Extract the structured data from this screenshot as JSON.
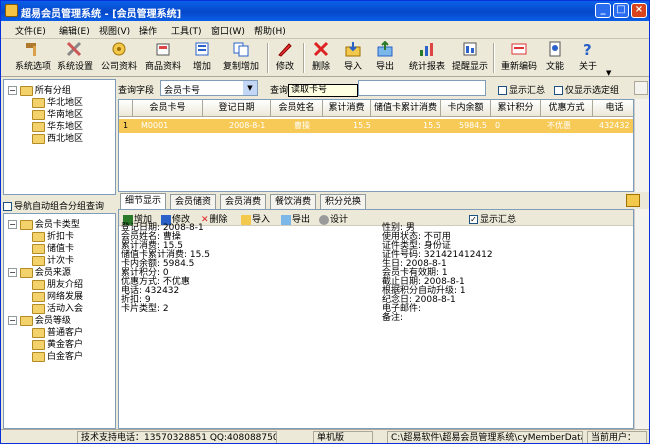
{
  "window": {
    "title": "超易会员管理系统 - [会员管理系统]",
    "minimize": "_",
    "restore": "□",
    "close": "×"
  },
  "menu": [
    "文件(E)",
    "编辑(E)",
    "视图(V)",
    "操作",
    "工具(T)",
    "窗口(W)",
    "帮助(H)"
  ],
  "toolbar": [
    "系统选项",
    "系统设置",
    "公司资料",
    "商品资料",
    "增加",
    "复制增加",
    "修改",
    "删除",
    "导入",
    "导出",
    "统计报表",
    "提醒显示",
    "重新编码",
    "文能",
    "关于"
  ],
  "tree": {
    "root": "所有分组",
    "items": [
      "华北地区",
      "华南地区",
      "华东地区",
      "西北地区"
    ]
  },
  "auto_nav": "导航自动组合分组查询",
  "tree2": {
    "groups": [
      {
        "label": "会员卡类型",
        "items": [
          "折扣卡",
          "储值卡",
          "计次卡"
        ]
      },
      {
        "label": "会员来源",
        "items": [
          "朋友介绍",
          "网络发展",
          "活动入会"
        ]
      },
      {
        "label": "会员等级",
        "items": [
          "普通客户",
          "黄金客户",
          "白金客户"
        ]
      }
    ]
  },
  "search": {
    "field_label": "查询字段",
    "field_value": "会员卡号",
    "query_label": "查询",
    "query_value": "",
    "tooltip": "读取卡号",
    "summary_check": "显示汇总",
    "selected_only": "仅显示选定组"
  },
  "grid": {
    "headers": [
      "会员卡号",
      "登记日期",
      "会员姓名",
      "累计消费",
      "储值卡累计消费",
      "卡内余额",
      "累计积分",
      "优惠方式",
      "电话"
    ],
    "row": {
      "marker": "1",
      "cells": [
        "M0001",
        "2008-8-1",
        "曹操",
        "15.5",
        "15.5",
        "5984.5",
        "0",
        "不优惠",
        "432432"
      ]
    }
  },
  "tabs": [
    "细节显示",
    "会员储资",
    "会员消费",
    "餐饮消费",
    "积分兑换"
  ],
  "detail_toolbar": {
    "add": "增加",
    "edit": "修改",
    "delete": "删除",
    "import": "导入",
    "export": "导出",
    "design": "设计",
    "show_summary": "显示汇总"
  },
  "detail_left": [
    "登记日期: 2008-8-1",
    "会员姓名: 曹操",
    "累计消费: 15.5",
    "储值卡累计消费: 15.5",
    "卡内余额: 5984.5",
    "累计积分: 0",
    "优惠方式: 不优惠",
    "电话: 432432",
    "折扣: 9",
    "卡片类型: 2"
  ],
  "detail_right": [
    "性别: 男",
    "使用状态: 不可用",
    "证件类型: 身份证",
    "证件号码: 321421412412",
    "生日: 2008-8-1",
    "会员卡有效期: 1",
    "截止日期: 2008-8-1",
    "根据积分自动升级: 1",
    "纪念日: 2008-8-1",
    "电子邮件:",
    "备注:"
  ],
  "status": {
    "support": "技术支持电话：13570328851 QQ:408088750",
    "edition": "单机版",
    "path": "C:\\超易软件\\超易会员管理系统\\cyMemberData.sys",
    "user": "当前用户："
  },
  "colors": {
    "title_bar": "#0a5fe8",
    "selected_row": "#f7ca57",
    "window_bg": "#ece9d8"
  }
}
